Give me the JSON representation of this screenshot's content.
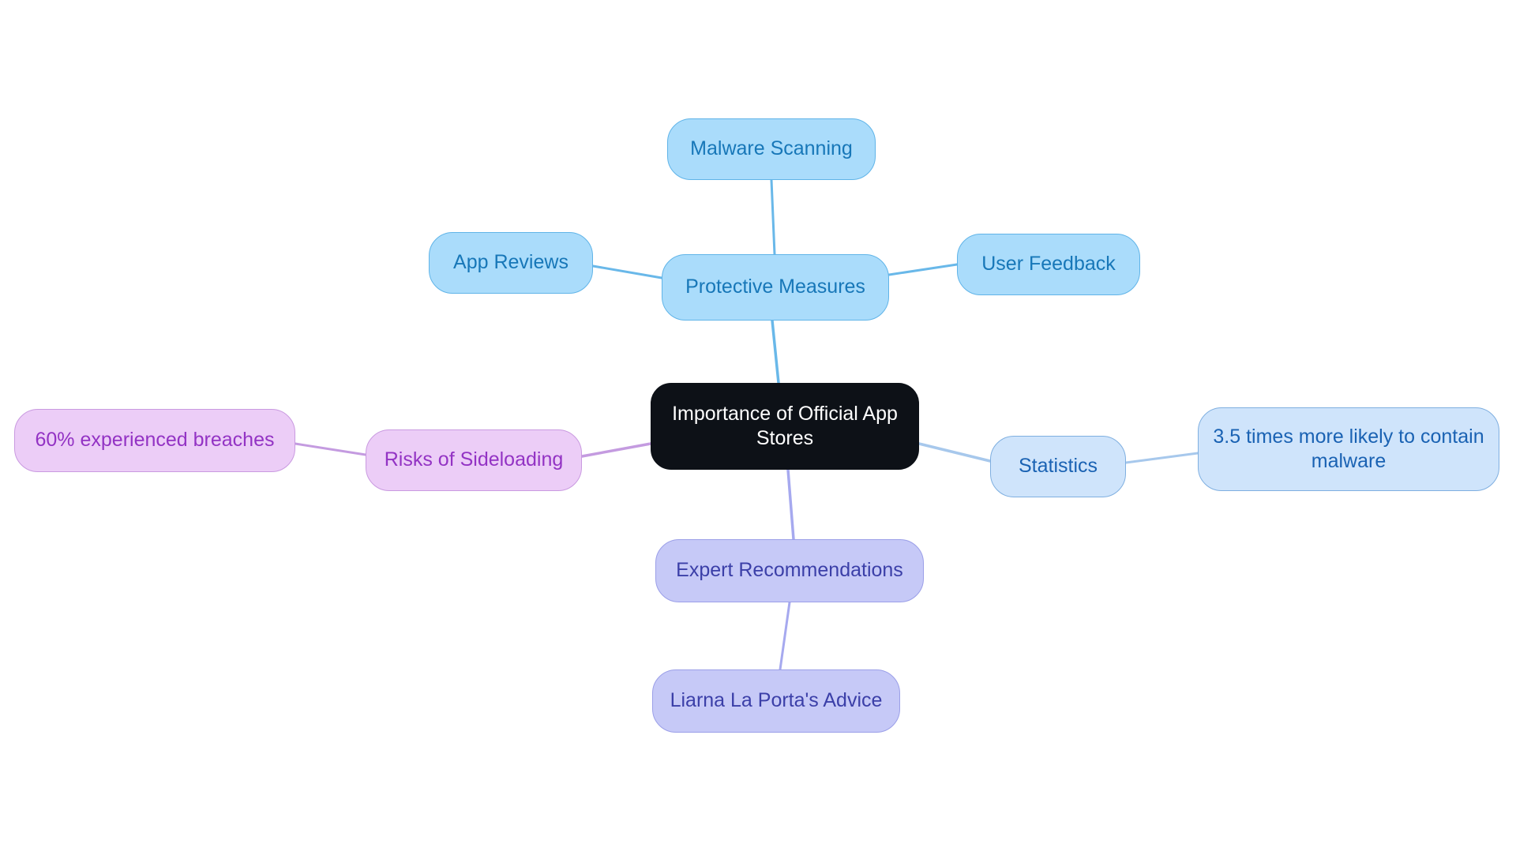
{
  "diagram": {
    "type": "mindmap",
    "background": "#ffffff",
    "root": {
      "id": "root",
      "label": "Importance of Official App Stores",
      "fill": "#0d1117",
      "text_color": "#ffffff"
    },
    "branches": [
      {
        "id": "protective-measures",
        "label": "Protective Measures",
        "fill": "#aadcfb",
        "border": "#60b4e8",
        "text_color": "#1777b8",
        "edge_color": "#69b8e9",
        "children": [
          {
            "id": "malware-scanning",
            "label": "Malware Scanning"
          },
          {
            "id": "app-reviews",
            "label": "App Reviews"
          },
          {
            "id": "user-feedback",
            "label": "User Feedback"
          }
        ]
      },
      {
        "id": "statistics",
        "label": "Statistics",
        "fill": "#cfe4fb",
        "border": "#7fafe0",
        "text_color": "#1a62b3",
        "edge_color": "#a7c8ec",
        "children": [
          {
            "id": "malware-likelihood",
            "label": "3.5 times more likely to contain malware"
          }
        ]
      },
      {
        "id": "risks-of-sideloading",
        "label": "Risks of Sideloading",
        "fill": "#eccdf7",
        "border": "#c99ae0",
        "text_color": "#9333c4",
        "edge_color": "#c49be0",
        "children": [
          {
            "id": "breaches",
            "label": "60% experienced breaches"
          }
        ]
      },
      {
        "id": "expert-recommendations",
        "label": "Expert Recommendations",
        "fill": "#c6c9f7",
        "border": "#9b9fe8",
        "text_color": "#3b3fa8",
        "edge_color": "#a6a9ef",
        "children": [
          {
            "id": "liarna-advice",
            "label": "Liarna La Porta's Advice"
          }
        ]
      }
    ]
  },
  "nodes": {
    "root": "Importance of Official App Stores",
    "protective_measures": "Protective Measures",
    "malware_scanning": "Malware Scanning",
    "app_reviews": "App Reviews",
    "user_feedback": "User Feedback",
    "statistics": "Statistics",
    "malware_likelihood": "3.5 times more likely to contain malware",
    "risks_of_sideloading": "Risks of Sideloading",
    "breaches": "60% experienced breaches",
    "expert_recommendations": "Expert Recommendations",
    "liarna_advice": "Liarna La Porta's Advice"
  }
}
